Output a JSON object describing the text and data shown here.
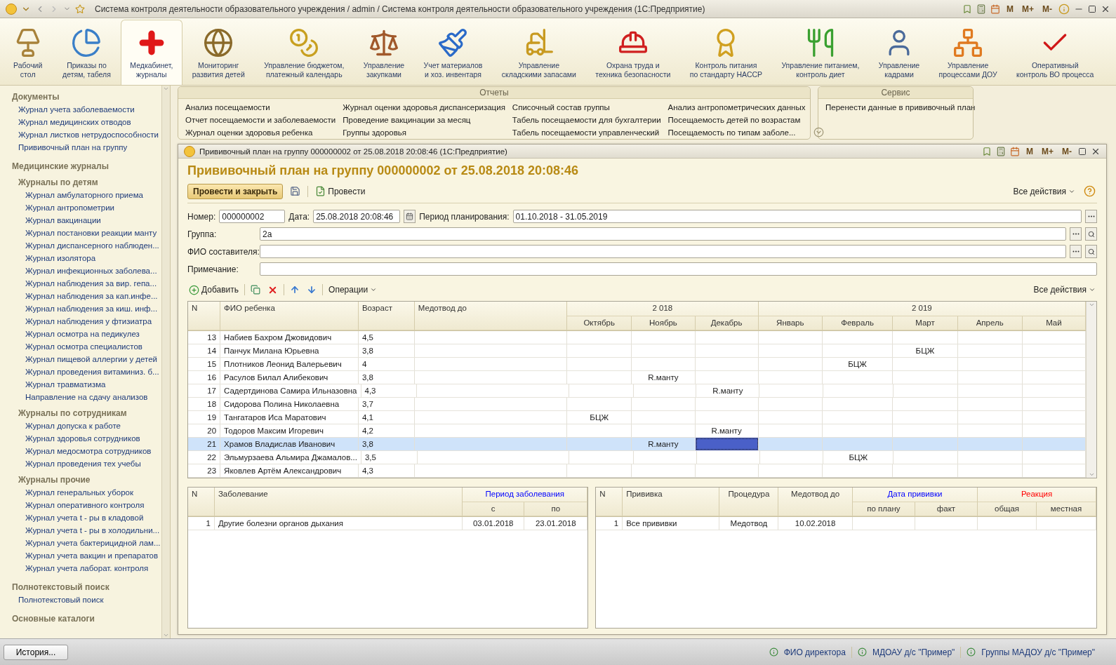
{
  "window": {
    "title": "Система контроля деятельности образовательного учреждения / admin / Система контроля деятельности образовательного учреждения  (1С:Предприятие)",
    "memory_buttons": [
      "M",
      "M+",
      "M-"
    ]
  },
  "toolbar": {
    "items": [
      {
        "label": "Рабочий\nстол",
        "selected": false
      },
      {
        "label": "Приказы по\nдетям, табеля",
        "selected": false
      },
      {
        "label": "Медкабинет,\nжурналы",
        "selected": true
      },
      {
        "label": "Мониторинг\nразвития детей",
        "selected": false
      },
      {
        "label": "Управление бюджетом,\nплатежный календарь",
        "selected": false
      },
      {
        "label": "Управление\nзакупками",
        "selected": false
      },
      {
        "label": "Учет материалов\nи хоз. инвентаря",
        "selected": false
      },
      {
        "label": "Управление\nскладскими запасами",
        "selected": false
      },
      {
        "label": "Охрана труда и\nтехника безопасности",
        "selected": false
      },
      {
        "label": "Контроль питания\nпо стандарту НАССР",
        "selected": false
      },
      {
        "label": "Управление питанием,\nконтроль диет",
        "selected": false
      },
      {
        "label": "Управление\nкадрами",
        "selected": false
      },
      {
        "label": "Управление\nпроцессами ДОУ",
        "selected": false
      },
      {
        "label": "Оперативный\nконтроль ВО процесса",
        "selected": false
      }
    ]
  },
  "sidebar": {
    "sections": [
      {
        "title": "Документы",
        "items": [
          "Журнал учета заболеваемости",
          "Журнал медицинских отводов",
          "Журнал листков нетрудоспособности",
          "Прививочный план на группу"
        ]
      },
      {
        "title": "Медицинские журналы",
        "groups": [
          {
            "title": "Журналы по детям",
            "items": [
              "Журнал амбулаторного приема",
              "Журнал антропометрии",
              "Журнал вакцинации",
              "Журнал постановки реакции манту",
              "Журнал диспансерного наблюден...",
              "Журнал изолятора",
              "Журнал инфекционных заболева...",
              "Журнал наблюдения за вир. гепа...",
              "Журнал наблюдения за кап.инфе...",
              "Журнал наблюдения за киш. инф...",
              "Журнал наблюдения у фтизиатра",
              "Журнал осмотра на педикулез",
              "Журнал осмотра специалистов",
              "Журнал пищевой аллергии у детей",
              "Журнал проведения витаминиз. б...",
              "Журнал травматизма",
              "Направление на сдачу анализов"
            ]
          },
          {
            "title": "Журналы по сотрудникам",
            "items": [
              "Журнал допуска к работе",
              "Журнал здоровья сотрудников",
              "Журнал медосмотра сотрудников",
              "Журнал проведения тех учебы"
            ]
          },
          {
            "title": "Журналы прочие",
            "items": [
              "Журнал генеральных уборок",
              "Журнал оперативного контроля",
              "Журнал учета  t - ры в кладовой",
              "Журнал учета  t - ры в холодильни...",
              "Журнал учета бактерицидной лам...",
              "Журнал учета вакцин и препаратов",
              "Журнал учета лаборат. контроля"
            ]
          }
        ]
      },
      {
        "title": "Полнотекстовый поиск",
        "items": [
          "Полнотекстовый поиск"
        ]
      },
      {
        "title": "Основные каталоги"
      }
    ]
  },
  "reports": {
    "title": "Отчеты",
    "columns": [
      [
        "Анализ посещаемости",
        "Отчет посещаемости и заболеваемости",
        "Журнал оценки здоровья ребенка"
      ],
      [
        "Журнал оценки здоровья диспансеризация",
        "Проведение вакцинации за месяц",
        "Группы здоровья"
      ],
      [
        "Списочный состав группы",
        "Табель посещаемости для бухгалтерии",
        "Табель посещаемости управленческий"
      ],
      [
        "Анализ антропометрических данных",
        "Посещаемость детей по возрастам",
        "Посещаемость по типам заболе..."
      ]
    ]
  },
  "service": {
    "title": "Сервис",
    "items": [
      "Перенести данные в прививочный план"
    ]
  },
  "document": {
    "window_title": "Прививочный план на группу 000000002 от 25.08.2018 20:08:46  (1С:Предприятие)",
    "memory_buttons": [
      "M",
      "M+",
      "M-"
    ],
    "heading": "Прививочный план на группу 000000002 от 25.08.2018 20:08:46",
    "commands": {
      "primary": "Провести и закрыть",
      "post": "Провести",
      "all_actions": "Все действия"
    },
    "fields": {
      "number": {
        "label": "Номер:",
        "value": "000000002"
      },
      "date": {
        "label": "Дата:",
        "value": "25.08.2018 20:08:46"
      },
      "period": {
        "label": "Период планирования:",
        "value": "01.10.2018 - 31.05.2019"
      },
      "group": {
        "label": "Группа:",
        "value": "2а"
      },
      "author": {
        "label": "ФИО составителя:"
      },
      "note": {
        "label": "Примечание:"
      }
    },
    "table_toolbar": {
      "add": "Добавить",
      "operations": "Операции",
      "all_actions": "Все действия"
    },
    "main_table": {
      "columns": [
        "N",
        "ФИО ребенка",
        "Возраст",
        "Медотвод до"
      ],
      "years": [
        {
          "label": "2 018",
          "months": [
            "Октябрь",
            "Ноябрь",
            "Декабрь"
          ]
        },
        {
          "label": "2 019",
          "months": [
            "Январь",
            "Февраль",
            "Март",
            "Апрель",
            "Май"
          ]
        }
      ],
      "rows": [
        {
          "n": "13",
          "name": "Набиев Бахром Джовидович",
          "age": "4,5",
          "selected": false
        },
        {
          "n": "14",
          "name": "Панчук Милана Юрьевна",
          "age": "3,8",
          "selected": false,
          "cells": [
            null,
            null,
            null,
            null,
            null,
            {
              "text": "БЦЖ",
              "current": false
            },
            null,
            null
          ]
        },
        {
          "n": "15",
          "name": "Плотников Леонид Валерьевич",
          "age": "4",
          "selected": false,
          "cells": [
            null,
            null,
            null,
            null,
            {
              "text": "БЦЖ",
              "current": false
            },
            null,
            null,
            null
          ]
        },
        {
          "n": "16",
          "name": "Расулов Билал Алибекович",
          "age": "3,8",
          "selected": false,
          "cells": [
            null,
            {
              "text": "R.манту",
              "current": false
            },
            null,
            null,
            null,
            null,
            null,
            null
          ]
        },
        {
          "n": "17",
          "name": "Садертдинова Самира Ильназовна",
          "age": "4,3",
          "selected": false,
          "cells": [
            null,
            null,
            {
              "text": "R.манту",
              "current": false
            },
            null,
            null,
            null,
            null,
            null
          ]
        },
        {
          "n": "18",
          "name": "Сидорова Полина Николаевна",
          "age": "3,7",
          "selected": false
        },
        {
          "n": "19",
          "name": "Тангатаров Иса Маратович",
          "age": "4,1",
          "selected": false,
          "cells": [
            {
              "text": "БЦЖ",
              "current": false
            },
            null,
            null,
            null,
            null,
            null,
            null,
            null
          ]
        },
        {
          "n": "20",
          "name": "Тодоров Максим Игоревич",
          "age": "4,2",
          "selected": false,
          "cells": [
            null,
            null,
            {
              "text": "R.манту",
              "current": false
            },
            null,
            null,
            null,
            null,
            null
          ]
        },
        {
          "n": "21",
          "name": "Храмов Владислав Иванович",
          "age": "3,8",
          "selected": true,
          "cells": [
            null,
            {
              "text": "R.манту",
              "current": false
            },
            {
              "current": true
            },
            null,
            null,
            null,
            null,
            null
          ]
        },
        {
          "n": "22",
          "name": "Эльмурзаева Альмира Джамалов...",
          "age": "3,5",
          "selected": false,
          "cells": [
            null,
            null,
            null,
            null,
            {
              "text": "БЦЖ",
              "current": false
            },
            null,
            null,
            null
          ]
        },
        {
          "n": "23",
          "name": "Яковлев Артём Александрович",
          "age": "4,3",
          "selected": false
        }
      ]
    },
    "illness_table": {
      "columns": [
        "N",
        "Заболевание"
      ],
      "groups": [
        {
          "label": "Период заболевания",
          "color": "#0000ff",
          "columns": [
            "с",
            "по"
          ]
        }
      ],
      "rows": [
        {
          "cells": [
            "1",
            "Другие болезни органов дыхания",
            "03.01.2018",
            "23.01.2018"
          ]
        }
      ]
    },
    "vaccine_table": {
      "columns": [
        "N",
        "Прививка",
        "Процедура",
        "Медотвод до"
      ],
      "groups": [
        {
          "label": "Дата прививки",
          "color": "#0000ff",
          "columns": [
            "по плану",
            "факт"
          ]
        },
        {
          "label": "Реакция",
          "color": "#ff0000",
          "columns": [
            "общая",
            "местная"
          ]
        }
      ],
      "rows": [
        {
          "cells": [
            "1",
            "Все прививки",
            "Медотвод",
            "10.02.2018"
          ]
        }
      ]
    }
  },
  "status_bar": {
    "history": "История...",
    "links": [
      "ФИО директора",
      "МДОАУ д/с \"Пример\"",
      "Группы МАДОУ д/с \"Пример\""
    ]
  }
}
